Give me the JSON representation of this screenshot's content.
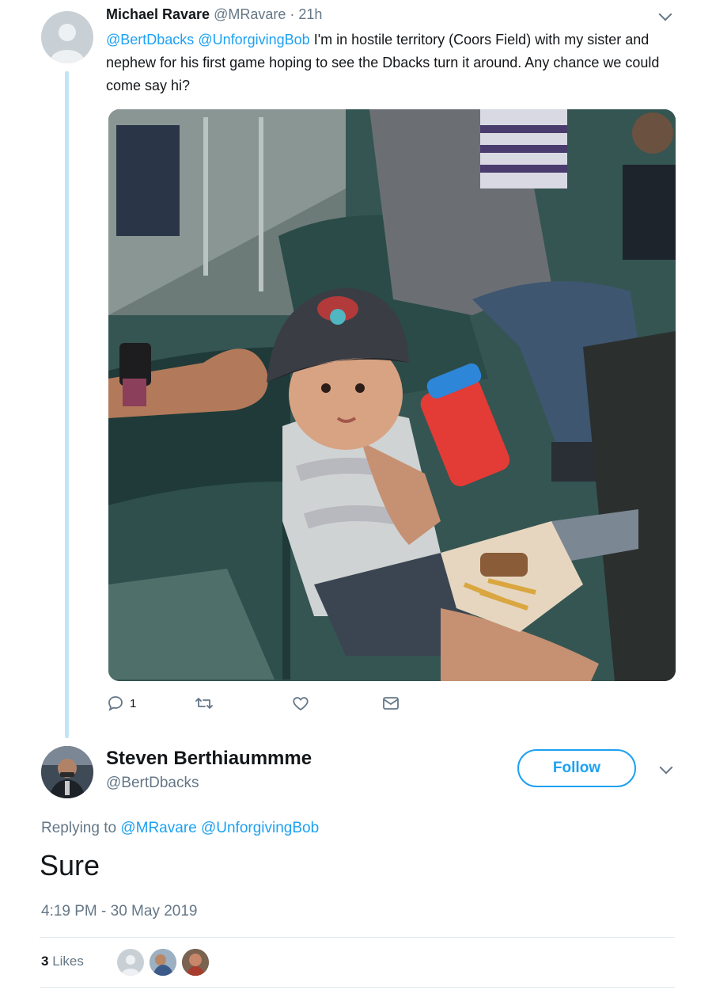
{
  "reply_tweet": {
    "author_name": "Michael Ravare",
    "author_handle": "@MRavare",
    "time_ago": "21h",
    "mention_1": "@BertDbacks",
    "mention_2": "@UnforgivingBob",
    "text": " I'm in hostile territory (Coors Field) with my sister and nephew for his first game hoping to see the Dbacks turn it around. Any chance we could come say hi?",
    "image_description": "Toddler in a Diamondbacks cap holding a red sippy cup, sitting in stadium seats with fries and a sandwich",
    "actions": {
      "reply_count": "1",
      "reply_icon": "reply-icon",
      "retweet_icon": "retweet-icon",
      "like_icon": "heart-icon",
      "dm_icon": "envelope-icon"
    }
  },
  "main_tweet": {
    "author_name": "Steven Berthiaummme",
    "author_handle": "@BertDbacks",
    "follow_label": "Follow",
    "replying_to_label": "Replying to",
    "replying_to_mentions": "@MRavare @UnforgivingBob",
    "text": "Sure",
    "timestamp": "4:19 PM - 30 May 2019",
    "likes_count": "3",
    "likes_label": "Likes"
  },
  "colors": {
    "accent": "#1da1f2",
    "text": "#14171a",
    "muted": "#657786",
    "thread_line": "#c4e3f7",
    "divider": "#e1e8ed"
  }
}
